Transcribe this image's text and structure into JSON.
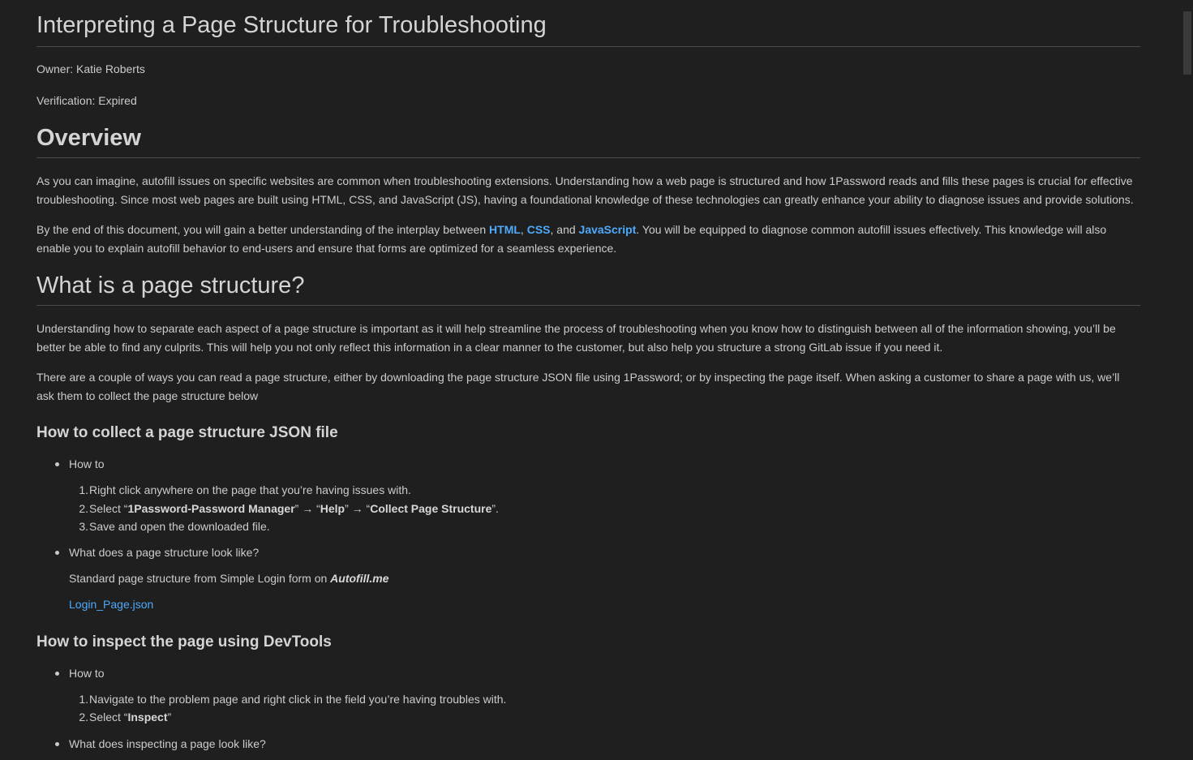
{
  "title": "Interpreting a Page Structure for Troubleshooting",
  "owner": "Owner: Katie Roberts",
  "verification": "Verification: Expired",
  "overview": {
    "heading": "Overview",
    "para1": "As you can imagine, autofill issues on specific websites are common when troubleshooting extensions. Understanding how a web page is structured and how 1Password reads and fills these pages is crucial for effective troubleshooting. Since most web pages are built using HTML, CSS, and JavaScript (JS), having a foundational knowledge of these technologies can greatly enhance your ability to diagnose issues and provide solutions.",
    "para2_pre": "By the end of this document, you will gain a better understanding of the interplay between ",
    "link_html": "HTML",
    "sep1": ", ",
    "link_css": "CSS",
    "sep2": ", and ",
    "link_js": "JavaScript",
    "para2_post": ". You will be equipped to diagnose common autofill issues effectively. This knowledge will also enable you to explain autofill behavior to end-users and ensure that forms are optimized for a seamless experience."
  },
  "page_structure": {
    "heading": "What is a page structure?",
    "para1": "Understanding how to separate each aspect of a page structure is important as it will help streamline the process of troubleshooting when you know how to distinguish between all of the information showing, you’ll be better be able to find any culprits. This will help you not only reflect this information in a clear manner to the customer, but also help you structure a strong GitLab issue if you need it.",
    "para2": "There are a couple of ways you can read a page structure, either by downloading the page structure JSON file using 1Password; or by inspecting the page itself. When asking a customer to share a page with us, we’ll ask them to collect the page structure below"
  },
  "collect_json": {
    "heading": "How to collect a page structure JSON file",
    "bullet1": "How to",
    "step1": "Right click anywhere on the page that you’re having issues with.",
    "step2_pre": "Select “",
    "step2_b1": "1Password-Password Manager",
    "step2_mid1": "” → “",
    "step2_b2": "Help",
    "step2_mid2": "” → “",
    "step2_b3": "Collect Page Structure",
    "step2_post": "”.",
    "step3": "Save and open the downloaded file.",
    "bullet2": "What does a page structure look like?",
    "standard_pre": "Standard page structure from Simple Login form on ",
    "standard_site": "Autofill.me",
    "file_link": "Login_Page.json"
  },
  "devtools": {
    "heading": "How to inspect the page using DevTools",
    "bullet1": "How to",
    "step1": "Navigate to the problem page and right click in the field you’re having troubles with.",
    "step2_pre": "Select “",
    "step2_b": "Inspect",
    "step2_post": "”",
    "bullet2": "What does inspecting a page look like?"
  }
}
